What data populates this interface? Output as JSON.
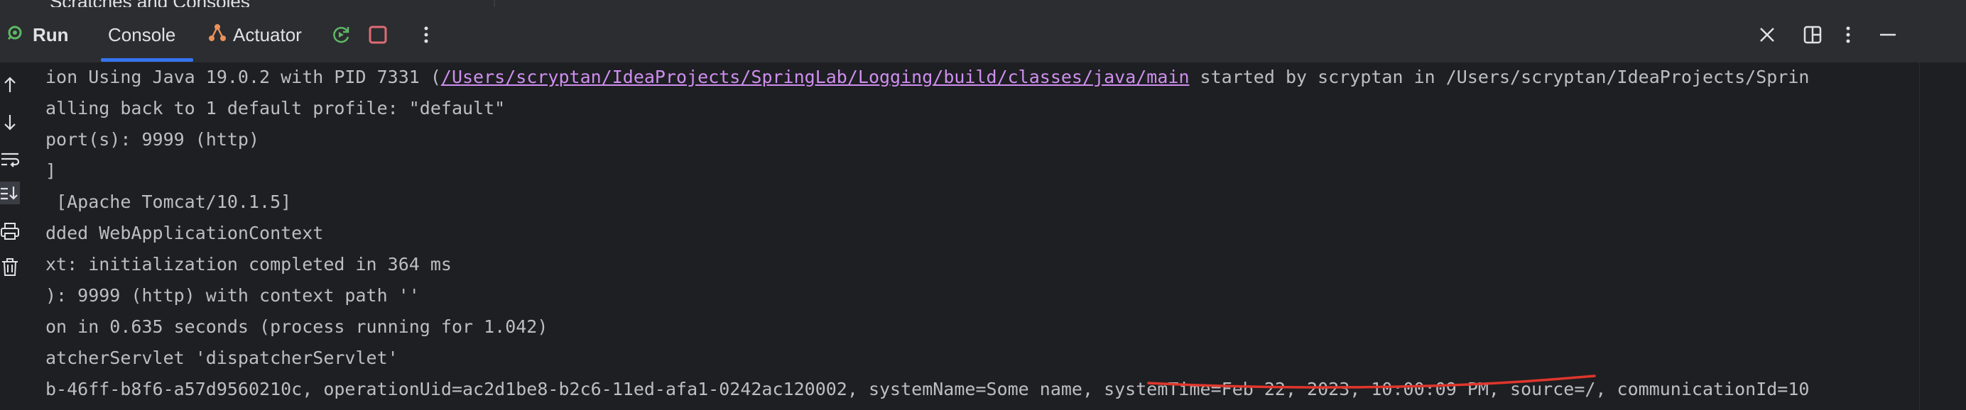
{
  "peek": {
    "label": "Scratches and Consoles"
  },
  "toolbar": {
    "run_label": "Run",
    "tabs": [
      {
        "label": "Console",
        "active": true
      },
      {
        "label": "Actuator",
        "active": false
      }
    ],
    "icons": {
      "rerun": "rerun-icon",
      "stop": "stop-icon",
      "more": "more-vertical-icon",
      "close": "close-icon",
      "layout": "layout-icon",
      "options": "options-icon",
      "minimize": "minimize-icon"
    },
    "colors": {
      "accent": "#3574f0",
      "stop": "#e06c75",
      "rerun": "#5fb865"
    }
  },
  "gutter": {
    "icons": [
      "arrow-up-icon",
      "arrow-down-icon",
      "soft-wrap-icon",
      "scroll-to-end-icon",
      "print-icon",
      "trash-icon"
    ]
  },
  "console": {
    "lines": [
      {
        "pre": "ion Using Java 19.0.2 with PID 7331 (",
        "link": "/Users/scryptan/IdeaProjects/SpringLab/Logging/build/classes/java/main",
        "post": " started by scryptan in /Users/scryptan/IdeaProjects/Sprin"
      },
      {
        "text": "alling back to 1 default profile: \"default\""
      },
      {
        "text": "port(s): 9999 (http)"
      },
      {
        "text": "]"
      },
      {
        "text": " [Apache Tomcat/10.1.5]"
      },
      {
        "text": "dded WebApplicationContext"
      },
      {
        "text": "xt: initialization completed in 364 ms"
      },
      {
        "text": "): 9999 (http) with context path ''"
      },
      {
        "text": "on in 0.635 seconds (process running for 1.042)"
      },
      {
        "text": "atcherServlet 'dispatcherServlet'"
      },
      {
        "text": "b-46ff-b8f6-a57d9560210c, operationUid=ac2d1be8-b2c6-11ed-afa1-0242ac120002, systemName=Some name, systemTime=Feb 22, 2023, 10:00:09 PM, source=/, communicationId=10"
      }
    ],
    "colors": {
      "text": "#bcbec4",
      "link": "#cf8ef0",
      "annotation": "#e0362c"
    }
  }
}
